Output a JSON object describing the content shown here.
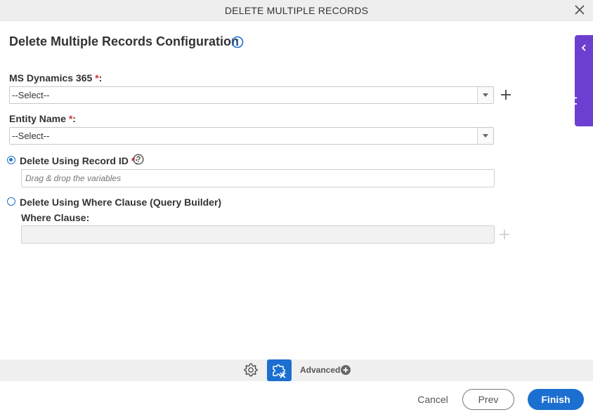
{
  "dialog": {
    "title": "DELETE MULTIPLE RECORDS"
  },
  "form": {
    "heading": "Delete Multiple Records Configuration",
    "ms_dynamics": {
      "label": "MS Dynamics 365",
      "required_mark": "*",
      "suffix": ":",
      "value": "--Select--"
    },
    "entity_name": {
      "label": "Entity Name",
      "required_mark": "*",
      "suffix": ":",
      "value": "--Select--"
    },
    "delete_by_id": {
      "label": "Delete Using Record ID",
      "required_mark": "*",
      "suffix": ":",
      "selected": true,
      "placeholder": "Drag & drop the variables"
    },
    "delete_by_where": {
      "label": "Delete Using Where Clause (Query Builder)",
      "selected": false,
      "where_label": "Where Clause:",
      "value": ""
    }
  },
  "side_panel": {
    "label": "App Data"
  },
  "toolbar": {
    "advanced_label": "Advanced"
  },
  "footer": {
    "cancel": "Cancel",
    "prev": "Prev",
    "finish": "Finish"
  },
  "colors": {
    "accent": "#1b6fd0",
    "side_tab": "#6d3fd0",
    "required": "#d9302d"
  }
}
